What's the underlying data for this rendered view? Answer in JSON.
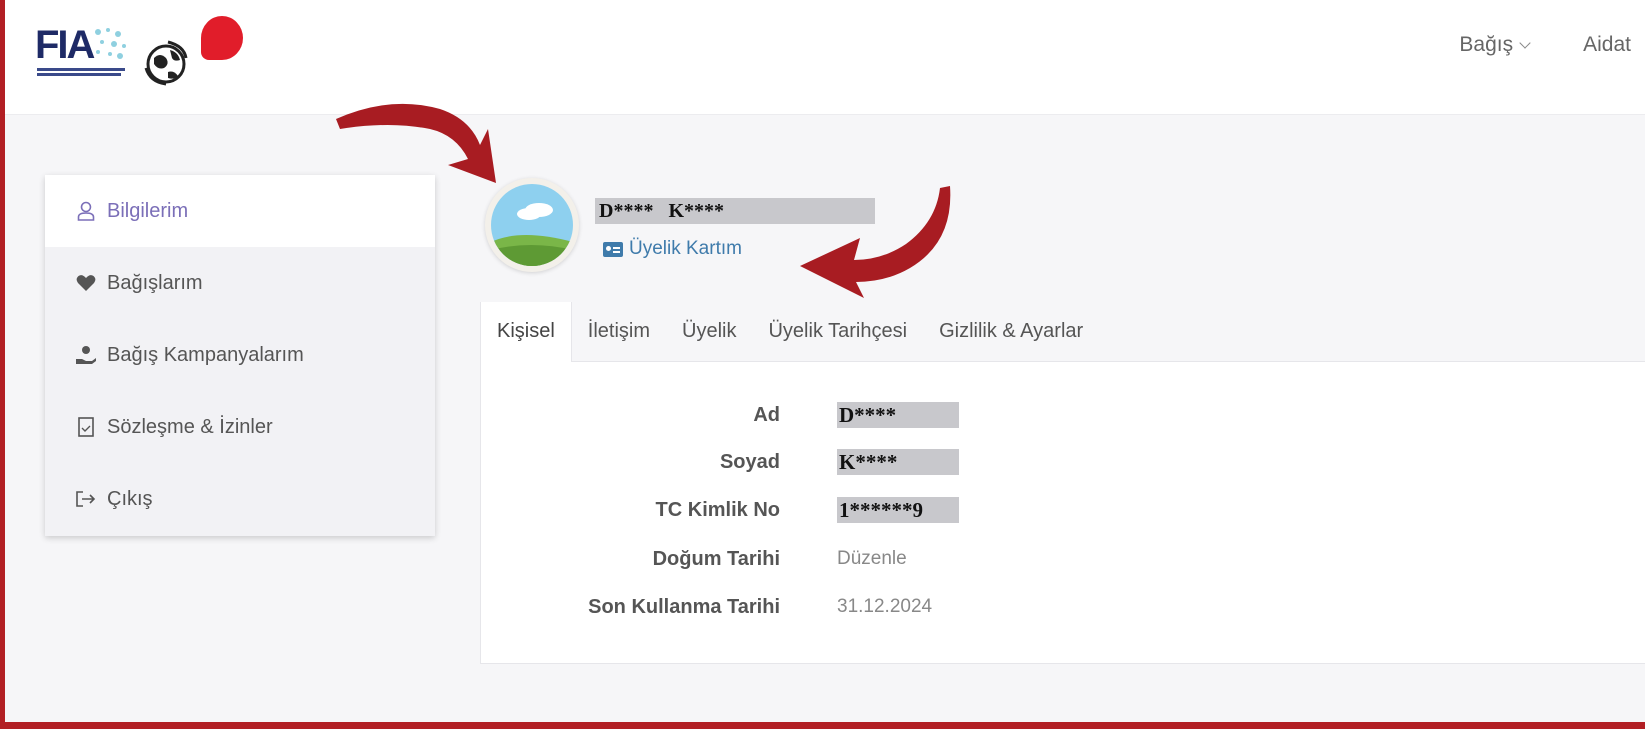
{
  "header": {
    "logo_text": "FIA",
    "nav": [
      {
        "label": "Bağış"
      },
      {
        "label": "Aidat"
      }
    ]
  },
  "sidebar": {
    "items": [
      {
        "label": "Bilgilerim",
        "icon": "user-icon"
      },
      {
        "label": "Bağışlarım",
        "icon": "heart-icon"
      },
      {
        "label": "Bağış Kampanyalarım",
        "icon": "hand-donation-icon"
      },
      {
        "label": "Sözleşme & İzinler",
        "icon": "document-icon"
      },
      {
        "label": "Çıkış",
        "icon": "logout-icon"
      }
    ]
  },
  "profile": {
    "name": "D**** K****",
    "card_link": "Üyelik Kartım"
  },
  "tabs": [
    {
      "label": "Kişisel"
    },
    {
      "label": "İletişim"
    },
    {
      "label": "Üyelik"
    },
    {
      "label": "Üyelik Tarihçesi"
    },
    {
      "label": "Gizlilik & Ayarlar"
    }
  ],
  "fields": [
    {
      "label": "Ad",
      "value": "D****"
    },
    {
      "label": "Soyad",
      "value": "K****"
    },
    {
      "label": "TC Kimlik No",
      "value": "1******9"
    },
    {
      "label": "Doğum Tarihi",
      "value": "Düzenle"
    },
    {
      "label": "Son Kullanma Tarihi",
      "value": "31.12.2024"
    }
  ],
  "colors": {
    "frame": "#b21f24",
    "active_sidebar": "#7b6fb8",
    "link": "#3f7bab",
    "arrow": "#a81c22"
  }
}
